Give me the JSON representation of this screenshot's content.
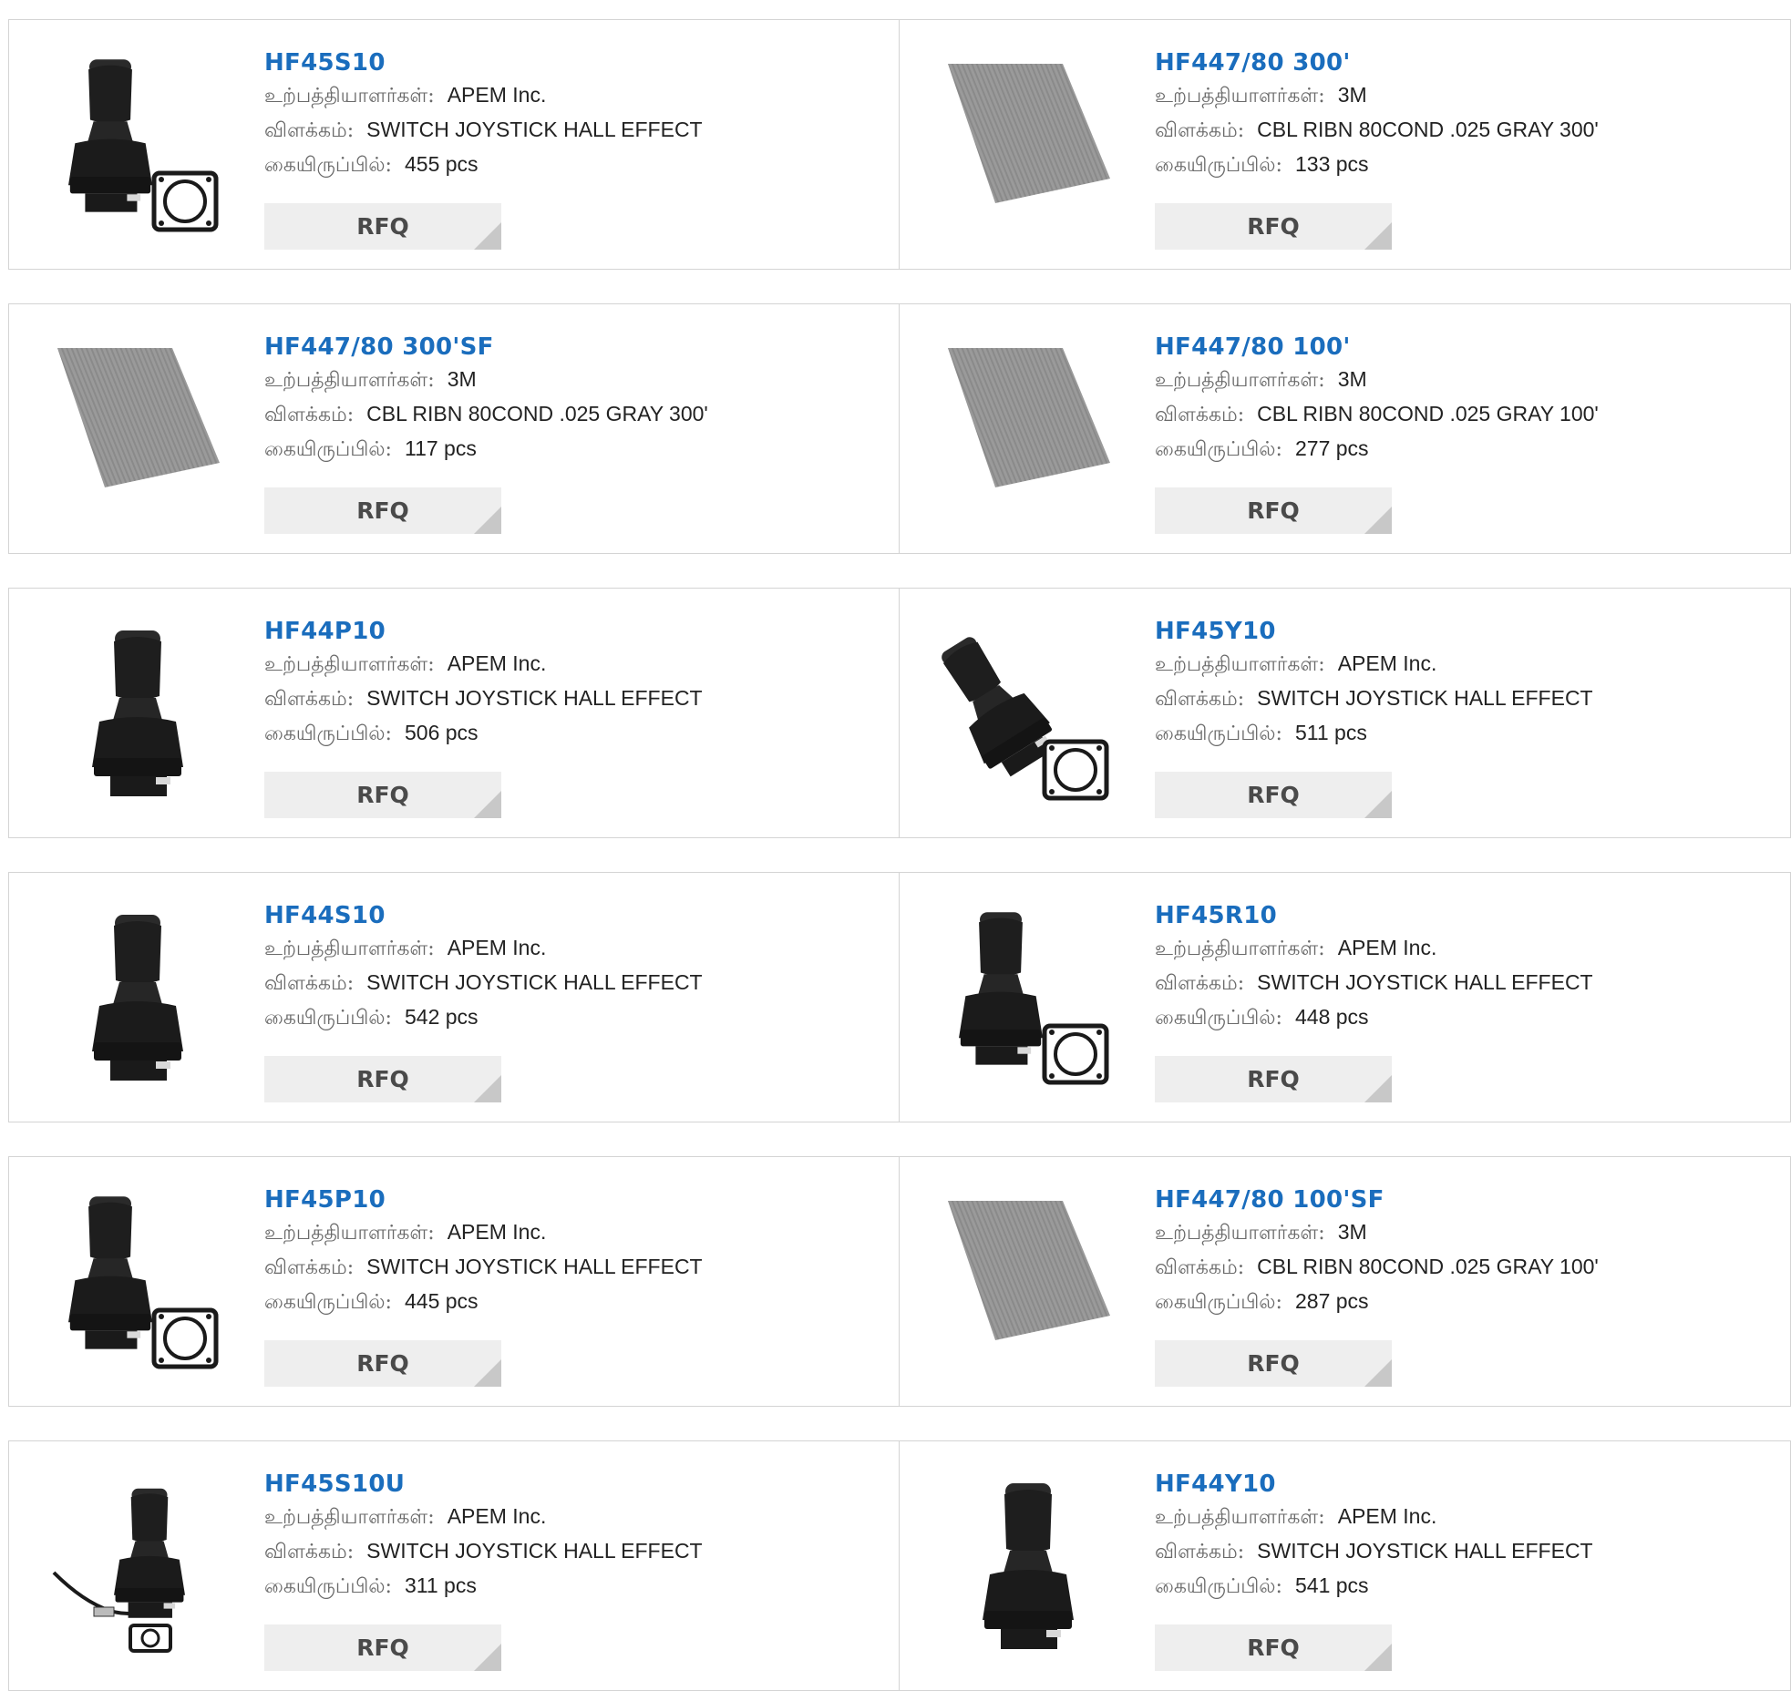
{
  "labels": {
    "manufacturer": "உற்பத்தியாளர்கள்:",
    "description": "விளக்கம்:",
    "stock": "கையிருப்பில்:",
    "rfq": "RFQ"
  },
  "colors": {
    "part_number": "#1a6dbd",
    "rfq_bg": "#eeeeee",
    "border": "#d4d4d4"
  },
  "products": [
    {
      "part": "HF45S10",
      "manufacturer": "APEM Inc.",
      "description": "SWITCH JOYSTICK HALL EFFECT",
      "stock": "455 pcs",
      "image": "joystick-with-gasket-icon"
    },
    {
      "part": "HF447/80 300'",
      "manufacturer": "3M",
      "description": "CBL RIBN 80COND .025 GRAY 300'",
      "stock": "133 pcs",
      "image": "ribbon-cable-icon"
    },
    {
      "part": "HF447/80 300'SF",
      "manufacturer": "3M",
      "description": "CBL RIBN 80COND .025 GRAY 300'",
      "stock": "117 pcs",
      "image": "ribbon-cable-icon"
    },
    {
      "part": "HF447/80 100'",
      "manufacturer": "3M",
      "description": "CBL RIBN 80COND .025 GRAY 100'",
      "stock": "277 pcs",
      "image": "ribbon-cable-icon"
    },
    {
      "part": "HF44P10",
      "manufacturer": "APEM Inc.",
      "description": "SWITCH JOYSTICK HALL EFFECT",
      "stock": "506 pcs",
      "image": "joystick-icon"
    },
    {
      "part": "HF45Y10",
      "manufacturer": "APEM Inc.",
      "description": "SWITCH JOYSTICK HALL EFFECT",
      "stock": "511 pcs",
      "image": "tilted-joystick-with-gasket-icon"
    },
    {
      "part": "HF44S10",
      "manufacturer": "APEM Inc.",
      "description": "SWITCH JOYSTICK HALL EFFECT",
      "stock": "542 pcs",
      "image": "joystick-icon"
    },
    {
      "part": "HF45R10",
      "manufacturer": "APEM Inc.",
      "description": "SWITCH JOYSTICK HALL EFFECT",
      "stock": "448 pcs",
      "image": "joystick-with-gasket-icon"
    },
    {
      "part": "HF45P10",
      "manufacturer": "APEM Inc.",
      "description": "SWITCH JOYSTICK HALL EFFECT",
      "stock": "445 pcs",
      "image": "joystick-with-gasket-icon"
    },
    {
      "part": "HF447/80 100'SF",
      "manufacturer": "3M",
      "description": "CBL RIBN 80COND .025 GRAY 100'",
      "stock": "287 pcs",
      "image": "ribbon-cable-icon"
    },
    {
      "part": "HF45S10U",
      "manufacturer": "APEM Inc.",
      "description": "SWITCH JOYSTICK HALL EFFECT",
      "stock": "311 pcs",
      "image": "joystick-with-usb-cable-icon"
    },
    {
      "part": "HF44Y10",
      "manufacturer": "APEM Inc.",
      "description": "SWITCH JOYSTICK HALL EFFECT",
      "stock": "541 pcs",
      "image": "joystick-icon"
    }
  ]
}
